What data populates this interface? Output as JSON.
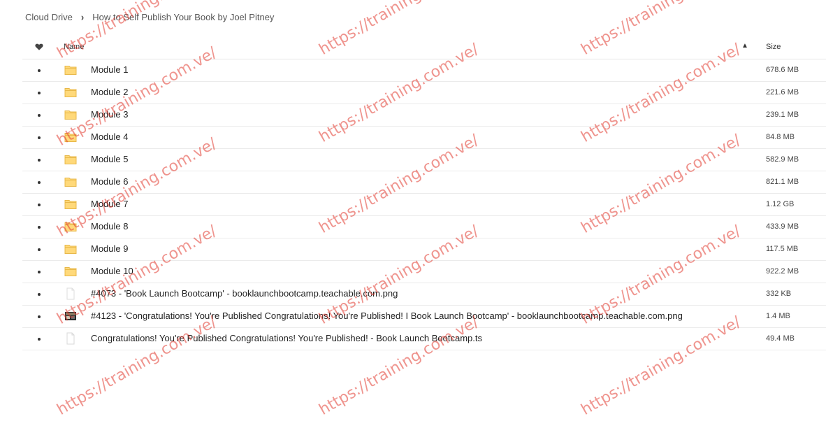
{
  "breadcrumb": {
    "root": "Cloud Drive",
    "separator": "›",
    "current": "How to Self Publish Your Book by Joel Pitney"
  },
  "table": {
    "header": {
      "name": "Name",
      "size": "Size",
      "sort_icon": "chevron-up-icon",
      "fav_icon": "heart-icon"
    },
    "rows": [
      {
        "type": "folder",
        "name": "Module 1",
        "size": "678.6 MB"
      },
      {
        "type": "folder",
        "name": "Module 2",
        "size": "221.6 MB"
      },
      {
        "type": "folder",
        "name": "Module 3",
        "size": "239.1 MB"
      },
      {
        "type": "folder",
        "name": "Module 4",
        "size": "84.8 MB"
      },
      {
        "type": "folder",
        "name": "Module 5",
        "size": "582.9 MB"
      },
      {
        "type": "folder",
        "name": "Module 6",
        "size": "821.1 MB"
      },
      {
        "type": "folder",
        "name": "Module 7",
        "size": "1.12 GB"
      },
      {
        "type": "folder",
        "name": "Module 8",
        "size": "433.9 MB"
      },
      {
        "type": "folder",
        "name": "Module 9",
        "size": "117.5 MB"
      },
      {
        "type": "folder",
        "name": "Module 10",
        "size": "922.2 MB"
      },
      {
        "type": "image-blank",
        "name": "#4073 - 'Book Launch Bootcamp' - booklaunchbootcamp.teachable.com.png",
        "size": "332 KB"
      },
      {
        "type": "image-thumb",
        "name": "#4123 - 'Congratulations! You're Published Congratulations! You're Published! I Book Launch Bootcamp' - booklaunchbootcamp.teachable.com.png",
        "size": "1.4 MB"
      },
      {
        "type": "file",
        "name": "Congratulations! You're Published Congratulations! You're Published! - Book Launch Bootcamp.ts",
        "size": "49.4 MB"
      }
    ]
  },
  "watermark": {
    "text": "https://training.com.ve/",
    "color": "#e23c32"
  },
  "colors": {
    "folder_fill": "#ffd97a",
    "folder_stroke": "#e8b84a",
    "divider": "#ebebeb"
  }
}
